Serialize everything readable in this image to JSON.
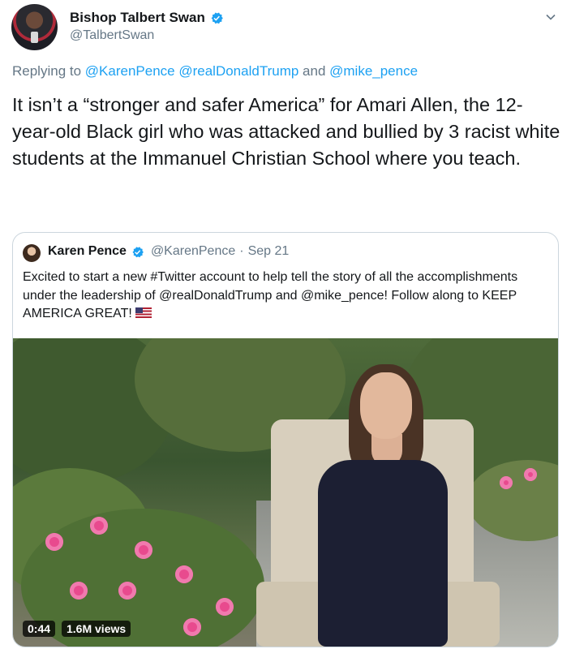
{
  "author": {
    "name": "Bishop Talbert Swan",
    "handle": "@TalbertSwan"
  },
  "reply": {
    "prefix": "Replying to ",
    "mentions": [
      "@KarenPence",
      "@realDonaldTrump"
    ],
    "and": " and ",
    "last_mention": "@mike_pence"
  },
  "tweet": {
    "text": "It isn’t a “stronger and safer America” for Amari Allen, the 12-year-old Black girl who was attacked and bullied by 3 racist white students at the Immanuel Christian School where you teach."
  },
  "quoted": {
    "name": "Karen Pence",
    "handle": "@KarenPence",
    "sep": " · ",
    "date": "Sep 21",
    "text": "Excited to start a new #Twitter account to help tell the story of all the accomplishments under the leadership of @realDonaldTrump and @mike_pence! Follow along to KEEP AMERICA GREAT!"
  },
  "video": {
    "duration": "0:44",
    "views": "1.6M views"
  },
  "colors": {
    "link": "#1da1f2",
    "verified": "#1da1f2",
    "muted": "#657786"
  },
  "icons": [
    "verified-badge-icon",
    "chevron-down-icon",
    "us-flag-emoji-icon"
  ]
}
